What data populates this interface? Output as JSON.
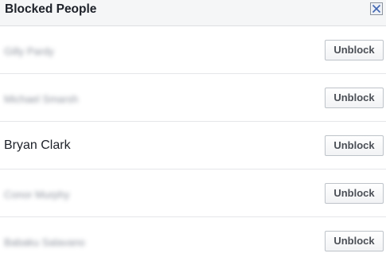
{
  "dialog": {
    "title": "Blocked People",
    "close_icon": "close-icon"
  },
  "blocked_list": {
    "items": [
      {
        "name": "Gilly Pardy",
        "blurred": true,
        "action_label": "Unblock"
      },
      {
        "name": "Michael Smarsh",
        "blurred": true,
        "action_label": "Unblock"
      },
      {
        "name": "Bryan Clark",
        "blurred": false,
        "action_label": "Unblock"
      },
      {
        "name": "Conor Murphy",
        "blurred": true,
        "action_label": "Unblock"
      },
      {
        "name": "Babaku Salavano",
        "blurred": true,
        "action_label": "Unblock"
      }
    ]
  },
  "colors": {
    "header_bg": "#f5f6f7",
    "divider": "#e5e6e9",
    "close_icon": "#4267b2",
    "button_text": "#4b4f56"
  }
}
